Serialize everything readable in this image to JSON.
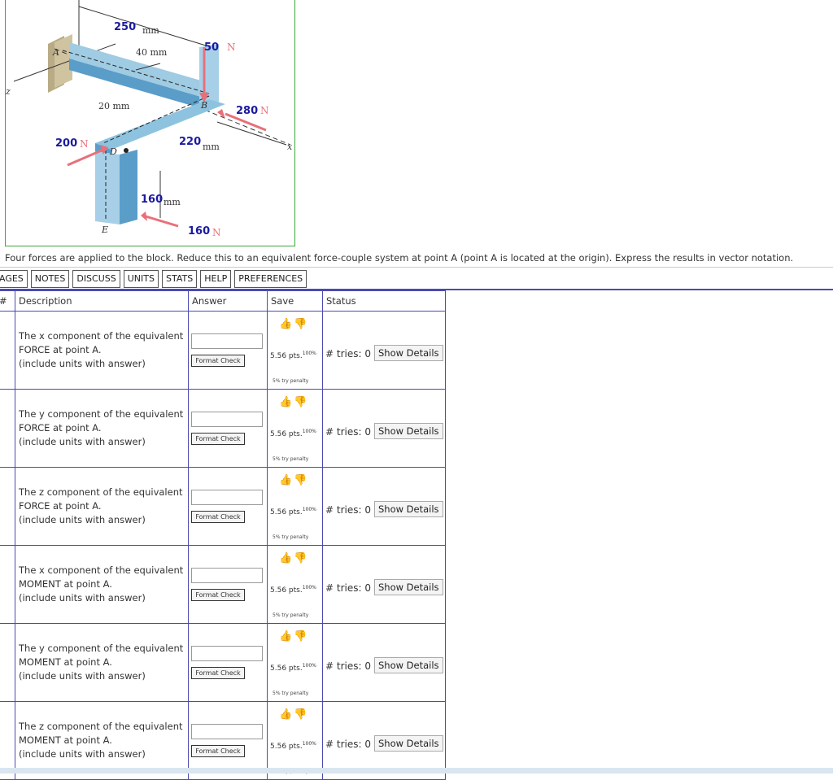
{
  "figure": {
    "dims": {
      "d250": "250",
      "d40": "40 mm",
      "d20": "20 mm",
      "d220": "220",
      "d160": "160",
      "mm": "mm"
    },
    "forces": {
      "f50": "50",
      "f280": "280",
      "f200": "200",
      "f160": "160",
      "unit": "N"
    },
    "points": {
      "A": "A",
      "B": "B",
      "D": "D",
      "E": "E",
      "x": "x",
      "z": "z"
    }
  },
  "problem_text": "Four forces are applied to the block. Reduce this to an equivalent force-couple system at point A (point A is located at the origin). Express the results in vector notation.",
  "tabs": [
    "AGES",
    "NOTES",
    "DISCUSS",
    "UNITS",
    "STATS",
    "HELP",
    "PREFERENCES"
  ],
  "table": {
    "headers": {
      "num": "#",
      "description": "Description",
      "answer": "Answer",
      "save": "Save",
      "status": "Status"
    },
    "rows": [
      {
        "line1": "The x component of the equivalent",
        "line2": "FORCE at point A.",
        "line3": "(include units with answer)"
      },
      {
        "line1": "The y component of the equivalent",
        "line2": "FORCE at point A.",
        "line3": "(include units with answer)"
      },
      {
        "line1": "The z component of the equivalent",
        "line2": "FORCE at point A.",
        "line3": "(include units with answer)"
      },
      {
        "line1": "The x component of the equivalent",
        "line2": "MOMENT at point A.",
        "line3": "(include units with answer)"
      },
      {
        "line1": "The y component of the equivalent",
        "line2": "MOMENT at point A.",
        "line3": "(include units with answer)"
      },
      {
        "line1": "The z component of the equivalent",
        "line2": "MOMENT at point A.",
        "line3": "(include units with answer)"
      }
    ],
    "format_check_label": "Format Check",
    "points_label": "5.56 pts.",
    "percent_label": "100%",
    "penalty_label": "5% try penalty",
    "tries_label": "# tries: 0",
    "show_details_label": "Show Details"
  },
  "icons": {
    "thumbs_up": "thumbs-up-icon",
    "thumbs_down": "thumbs-down-icon"
  },
  "colors": {
    "border_blue": "#4a4ab0",
    "figure_border": "#3aa83a",
    "force_red": "#e8707a",
    "dim_blue": "#1a1aa0"
  }
}
